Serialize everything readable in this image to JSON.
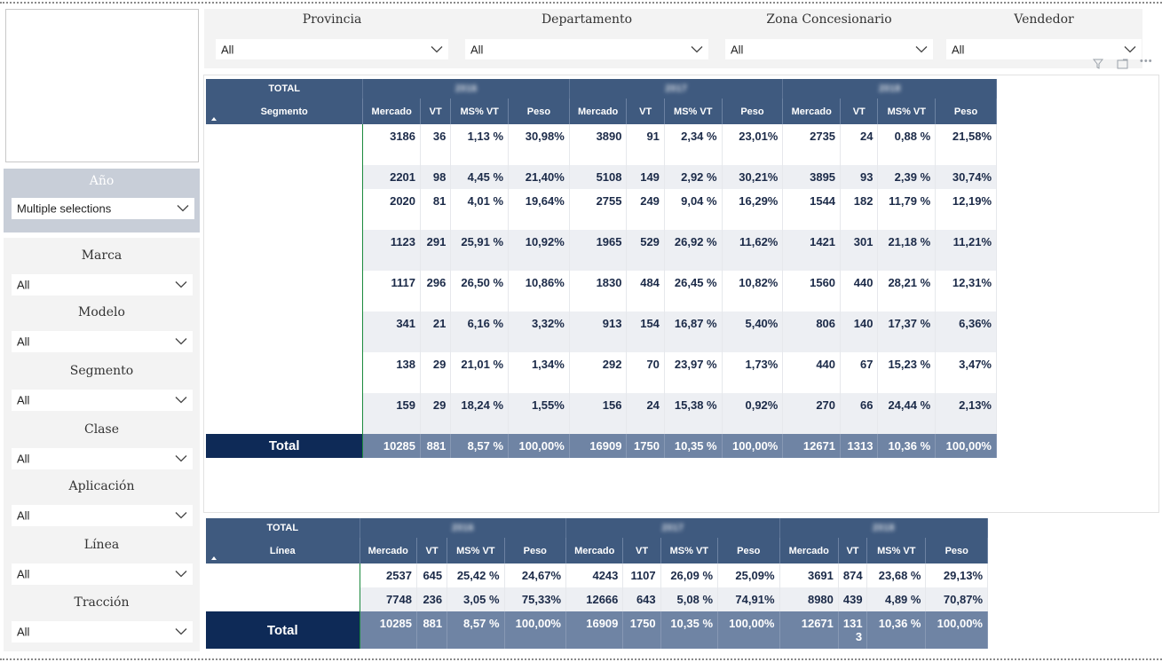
{
  "filters_top": [
    {
      "label": "Provincia",
      "value": "All"
    },
    {
      "label": "Departamento",
      "value": "All"
    },
    {
      "label": "Zona Concesionario",
      "value": "All"
    },
    {
      "label": "Vendedor",
      "value": "All"
    }
  ],
  "year_slicer": {
    "label": "Año",
    "value": "Multiple selections"
  },
  "side_slicers": [
    {
      "label": "Marca",
      "value": "All"
    },
    {
      "label": "Modelo",
      "value": "All"
    },
    {
      "label": "Segmento",
      "value": "All"
    },
    {
      "label": "Clase",
      "value": "All"
    },
    {
      "label": "Aplicación",
      "value": "All"
    },
    {
      "label": "Línea",
      "value": "All"
    },
    {
      "label": "Tracción",
      "value": "All"
    }
  ],
  "icons": {
    "filter": "filter-icon",
    "focus": "focus-mode-icon",
    "more": "more-options-icon",
    "chevron": "chevron-down-icon",
    "sort": "sort-ascending-icon"
  },
  "matrix1": {
    "total_label": "TOTAL",
    "row_header": "Segmento",
    "year_labels": [
      "2016",
      "2017",
      "2018"
    ],
    "measures": [
      "Mercado",
      "VT",
      "MS% VT",
      "Peso"
    ],
    "rows": [
      [
        "3186",
        "36",
        "1,13 %",
        "30,98%",
        "3890",
        "91",
        "2,34 %",
        "23,01%",
        "2735",
        "24",
        "0,88 %",
        "21,58%"
      ],
      [
        "2201",
        "98",
        "4,45 %",
        "21,40%",
        "5108",
        "149",
        "2,92 %",
        "30,21%",
        "3895",
        "93",
        "2,39 %",
        "30,74%"
      ],
      [
        "2020",
        "81",
        "4,01 %",
        "19,64%",
        "2755",
        "249",
        "9,04 %",
        "16,29%",
        "1544",
        "182",
        "11,79 %",
        "12,19%"
      ],
      [
        "1123",
        "291",
        "25,91 %",
        "10,92%",
        "1965",
        "529",
        "26,92 %",
        "11,62%",
        "1421",
        "301",
        "21,18 %",
        "11,21%"
      ],
      [
        "1117",
        "296",
        "26,50 %",
        "10,86%",
        "1830",
        "484",
        "26,45 %",
        "10,82%",
        "1560",
        "440",
        "28,21 %",
        "12,31%"
      ],
      [
        "341",
        "21",
        "6,16 %",
        "3,32%",
        "913",
        "154",
        "16,87 %",
        "5,40%",
        "806",
        "140",
        "17,37 %",
        "6,36%"
      ],
      [
        "138",
        "29",
        "21,01 %",
        "1,34%",
        "292",
        "70",
        "23,97 %",
        "1,73%",
        "440",
        "67",
        "15,23 %",
        "3,47%"
      ],
      [
        "159",
        "29",
        "18,24 %",
        "1,55%",
        "156",
        "24",
        "15,38 %",
        "0,92%",
        "270",
        "66",
        "24,44 %",
        "2,13%"
      ]
    ],
    "total_row_label": "Total",
    "total_row": [
      "10285",
      "881",
      "8,57 %",
      "100,00%",
      "16909",
      "1750",
      "10,35 %",
      "100,00%",
      "12671",
      "1313",
      "10,36 %",
      "100,00%"
    ]
  },
  "matrix2": {
    "total_label": "TOTAL",
    "row_header": "Línea",
    "year_labels": [
      "2016",
      "2017",
      "2018"
    ],
    "measures": [
      "Mercado",
      "VT",
      "MS% VT",
      "Peso"
    ],
    "rows": [
      [
        "2537",
        "645",
        "25,42 %",
        "24,67%",
        "4243",
        "1107",
        "26,09 %",
        "25,09%",
        "3691",
        "874",
        "23,68 %",
        "29,13%"
      ],
      [
        "7748",
        "236",
        "3,05 %",
        "75,33%",
        "12666",
        "643",
        "5,08 %",
        "74,91%",
        "8980",
        "439",
        "4,89 %",
        "70,87%"
      ]
    ],
    "total_row_label": "Total",
    "total_row": [
      "10285",
      "881",
      "8,57 %",
      "100,00%",
      "16909",
      "1750",
      "10,35 %",
      "100,00%",
      "12671",
      "131 3",
      "10,36 %",
      "100,00%"
    ]
  }
}
